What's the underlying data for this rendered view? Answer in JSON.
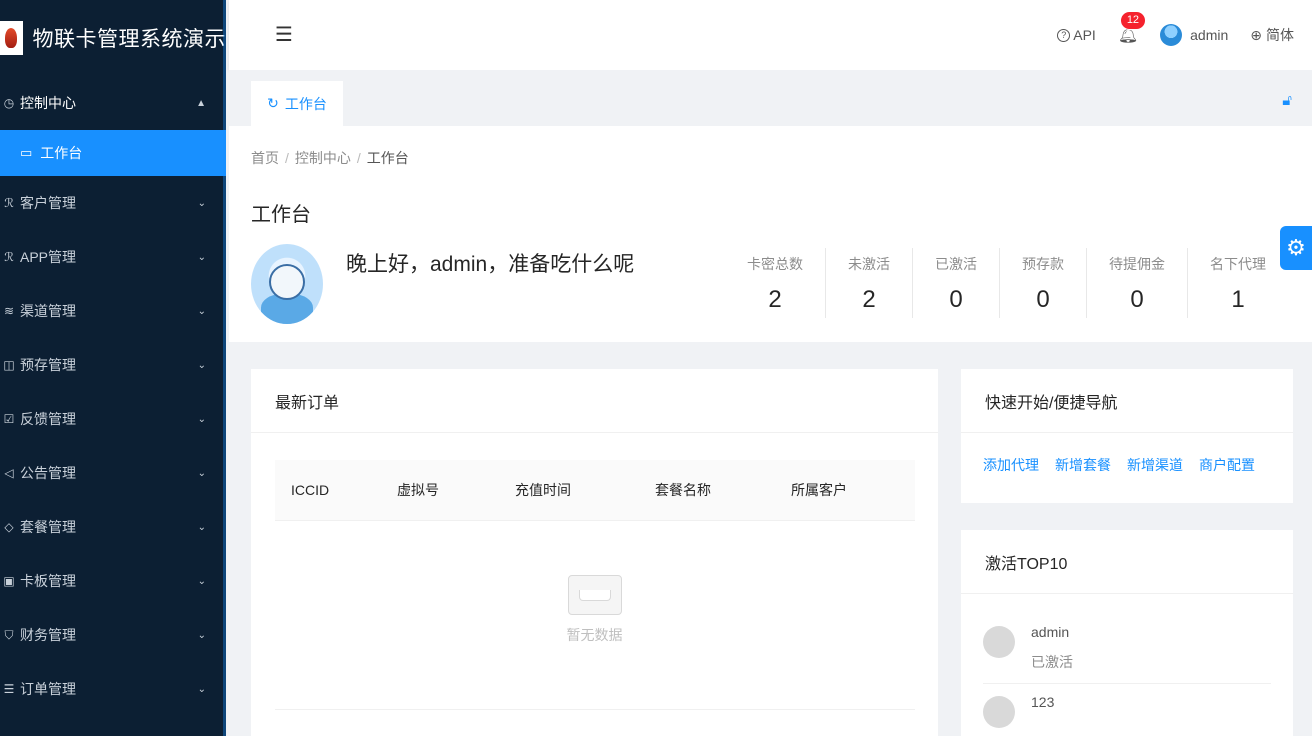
{
  "app": {
    "title": "物联卡管理系统演示"
  },
  "sidebar": {
    "items": [
      {
        "label": "控制中心",
        "icon": "gauge-icon",
        "arrow": "▲"
      },
      {
        "label": "工作台",
        "icon": "monitor-icon",
        "active": true
      },
      {
        "label": "客户管理",
        "icon": "user-icon",
        "arrow": "⌄"
      },
      {
        "label": "APP管理",
        "icon": "app-icon",
        "arrow": "⌄"
      },
      {
        "label": "渠道管理",
        "icon": "channel-icon",
        "arrow": "⌄"
      },
      {
        "label": "预存管理",
        "icon": "deposit-icon",
        "arrow": "⌄"
      },
      {
        "label": "反馈管理",
        "icon": "feedback-icon",
        "arrow": "⌄"
      },
      {
        "label": "公告管理",
        "icon": "notice-icon",
        "arrow": "⌄"
      },
      {
        "label": "套餐管理",
        "icon": "package-icon",
        "arrow": "⌄"
      },
      {
        "label": "卡板管理",
        "icon": "card-icon",
        "arrow": "⌄"
      },
      {
        "label": "财务管理",
        "icon": "finance-icon",
        "arrow": "⌄"
      },
      {
        "label": "订单管理",
        "icon": "order-icon",
        "arrow": "⌄"
      }
    ]
  },
  "header": {
    "api_label": "API",
    "notification_count": "12",
    "username": "admin",
    "language": "简体"
  },
  "tabs": [
    {
      "label": "工作台"
    }
  ],
  "breadcrumb": {
    "home": "首页",
    "section": "控制中心",
    "current": "工作台"
  },
  "page": {
    "title": "工作台",
    "greeting": "晚上好，admin，准备吃什么呢"
  },
  "stats": [
    {
      "label": "卡密总数",
      "value": "2"
    },
    {
      "label": "未激活",
      "value": "2"
    },
    {
      "label": "已激活",
      "value": "0"
    },
    {
      "label": "预存款",
      "value": "0"
    },
    {
      "label": "待提佣金",
      "value": "0"
    },
    {
      "label": "名下代理",
      "value": "1"
    }
  ],
  "orders": {
    "title": "最新订单",
    "columns": [
      "ICCID",
      "虚拟号",
      "充值时间",
      "套餐名称",
      "所属客户"
    ],
    "empty_text": "暂无数据"
  },
  "quick_nav": {
    "title": "快速开始/便捷导航",
    "links": [
      "添加代理",
      "新增套餐",
      "新增渠道",
      "商户配置"
    ]
  },
  "top10": {
    "title": "激活TOP10",
    "items": [
      {
        "name": "admin",
        "status": "已激活"
      },
      {
        "name": "123",
        "status": ""
      }
    ]
  },
  "colors": {
    "sidebar_bg": "#0c1f33",
    "accent": "#1890ff",
    "badge": "#f5222d"
  }
}
